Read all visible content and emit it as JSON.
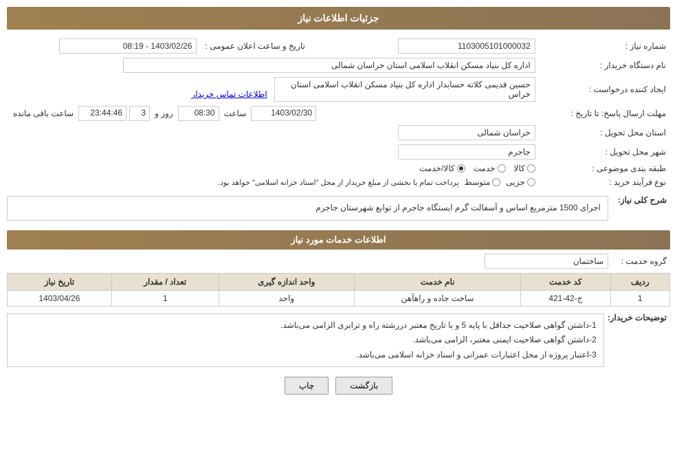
{
  "page": {
    "title": "جزئیات اطلاعات نیاز",
    "sections": {
      "info": "جزئیات اطلاعات نیاز",
      "services": "اطلاعات خدمات مورد نیاز"
    }
  },
  "fields": {
    "shomareNiaz_label": "شماره نیاز :",
    "shomareNiaz_value": "1103005101000032",
    "tarikhLabel": "تاریخ و ساعت اعلان عمومی :",
    "tarikhValue": "1403/02/26 - 08:19",
    "namDastgah_label": "نام دستگاه خریدار :",
    "namDastgah_value": "اداره کل بنیاد مسکن انقلاب اسلامی استان خراسان شمالی",
    "ijadLabel": "ایجاد کننده درخواست :",
    "ijadValue": "حسین قدیمی کلاته حسابدار اداره کل بنیاد مسکن انقلاب اسلامی استان خراس",
    "ijadLink": "اطلاعات تماس خریدار",
    "mohlat_label": "مهلت ارسال پاسخ: تا تاریخ :",
    "tarikh_date": "1403/02/30",
    "tarikh_saat": "08:30",
    "tarikh_rooz": "3",
    "tarikh_maandeh": "23:44:46",
    "ostan_label": "استان محل تحویل :",
    "ostan_value": "خراسان شمالی",
    "shahr_label": "شهر محل تحویل :",
    "shahr_value": "جاجرم",
    "tabaqehbandi_label": "طبقه بندی موضوعی :",
    "tabaqehbandi_kala": "کالا",
    "tabaqehbandi_khedmat": "خدمت",
    "tabaqehbandi_kalaKhedmat": "کالا/خدمت",
    "noeFarayand_label": "نوع فرآیند خرید :",
    "noeFarayand_jozi": "جزیی",
    "noeFarayand_motavaset": "متوسط",
    "noeFarayand_desc": "پرداخت تمام یا بخشی از مبلغ خریدار از محل \"اسناد خزانه اسلامی\" خواهد بود.",
    "sharh_label": "شرح کلی نیاز:",
    "sharh_value": "اجرای 1500 مترمربع اساس و آسفالت گرم ایستگاه جاجرم از توابع شهرستان جاجرم",
    "grooh_label": "گروه خدمت :",
    "grooh_value": "ساختمان",
    "table": {
      "headers": [
        "ردیف",
        "کد خدمت",
        "نام خدمت",
        "واحد اندازه گیری",
        "تعداد / مقدار",
        "تاریخ نیاز"
      ],
      "rows": [
        {
          "radif": "1",
          "kod": "ج-42-421",
          "nam": "ساخت جاده و راهآهن",
          "vahed": "واحد",
          "tedad": "1",
          "tarikh": "1403/04/26"
        }
      ]
    },
    "tosifat_label": "توضیحات خریدار:",
    "tosifat_lines": [
      "1-داشتن گواهی صلاحیت جداقل با پایه 5 و با تاریخ معتبر دررشته راه و ترابری الزامی می‌باشد.",
      "2-داشتن گواهی صلاحیت ایمنی معتبر، الزامی می‌باشد.",
      "3-اعتبار پروژه از محل اعتبارات عمرانی و اسناد خزانه اسلامی می‌باشد."
    ],
    "buttons": {
      "chap": "چاپ",
      "bazgasht": "بازگشت"
    }
  }
}
